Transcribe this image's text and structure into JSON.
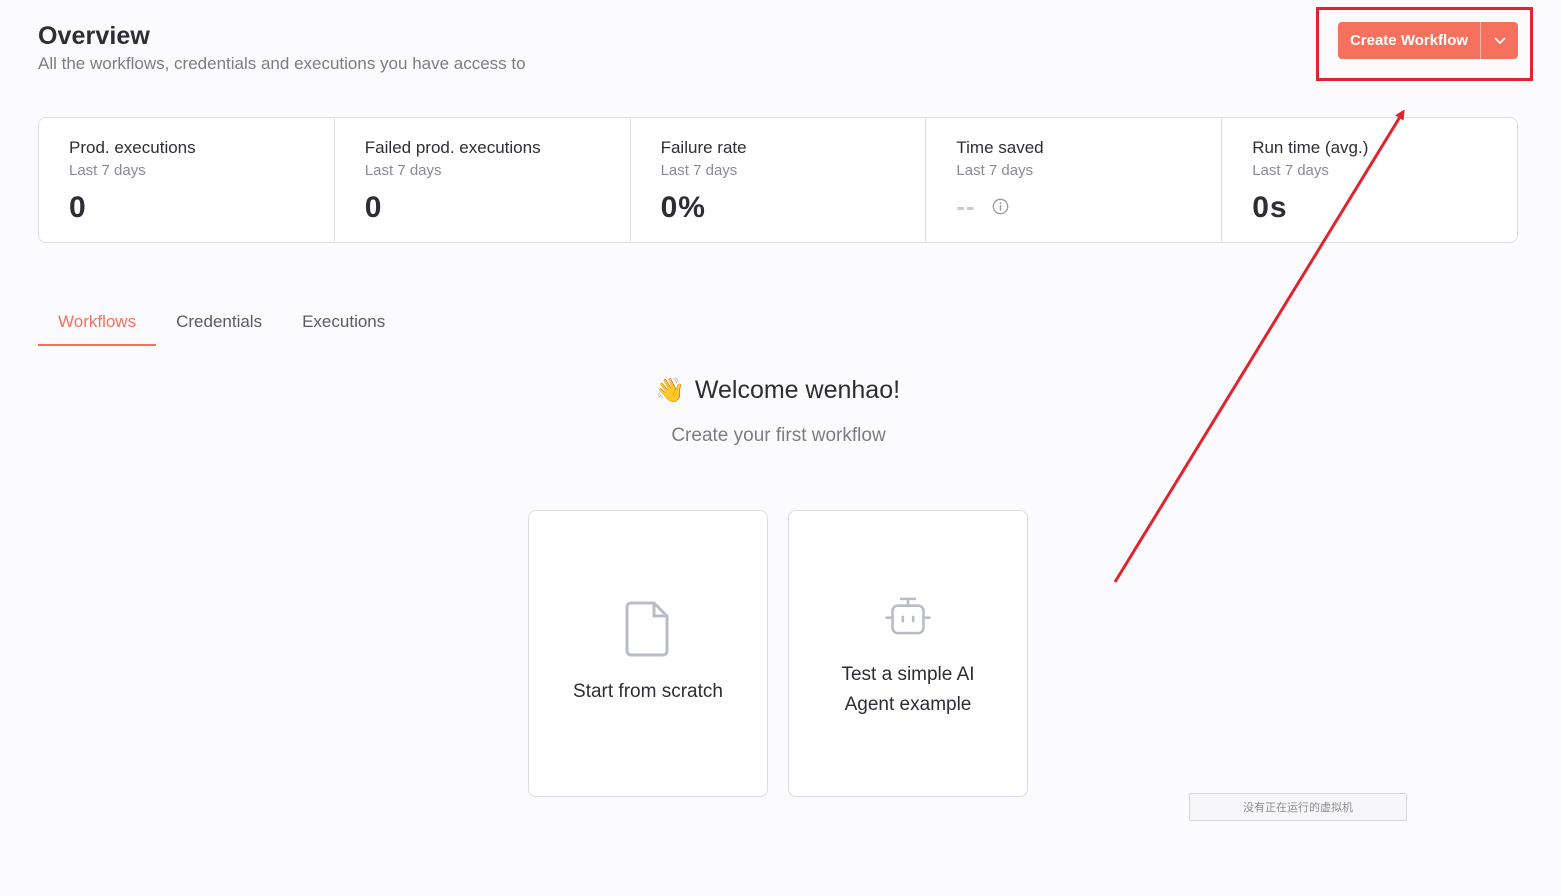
{
  "header": {
    "title": "Overview",
    "subtitle": "All the workflows, credentials and executions you have access to",
    "create_button_label": "Create Workflow"
  },
  "stats": [
    {
      "label": "Prod. executions",
      "sub": "Last 7 days",
      "value": "0"
    },
    {
      "label": "Failed prod. executions",
      "sub": "Last 7 days",
      "value": "0"
    },
    {
      "label": "Failure rate",
      "sub": "Last 7 days",
      "value": "0%"
    },
    {
      "label": "Time saved",
      "sub": "Last 7 days",
      "value": "--"
    },
    {
      "label": "Run time (avg.)",
      "sub": "Last 7 days",
      "value": "0s"
    }
  ],
  "tabs": [
    {
      "label": "Workflows",
      "active": true
    },
    {
      "label": "Credentials",
      "active": false
    },
    {
      "label": "Executions",
      "active": false
    }
  ],
  "welcome": {
    "emoji": "👋",
    "title": "Welcome wenhao!",
    "subtitle": "Create your first workflow"
  },
  "cards": [
    {
      "label": "Start from scratch",
      "icon": "file-icon"
    },
    {
      "label": "Test a simple AI Agent example",
      "icon": "robot-icon"
    }
  ],
  "vm_status": "没有正在运行的虚拟机",
  "colors": {
    "accent": "#f5715e",
    "annotation": "#e0242f"
  }
}
